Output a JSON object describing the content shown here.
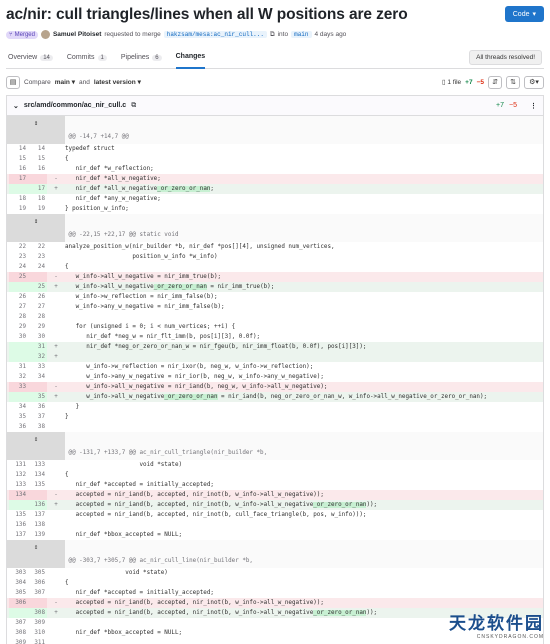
{
  "header": {
    "title": "ac/nir: cull triangles/lines when all W positions are zero",
    "code_button": "Code",
    "status": "Merged",
    "author": "Samuel Pitoiset",
    "request_text": "requested to merge",
    "source_branch": "hakzsam/mesa:ac_nir_cull...",
    "into_text": "into",
    "target_branch": "main",
    "time": "4 days ago"
  },
  "tabs": [
    {
      "label": "Overview",
      "count": "14"
    },
    {
      "label": "Commits",
      "count": "1"
    },
    {
      "label": "Pipelines",
      "count": "6"
    },
    {
      "label": "Changes",
      "count": ""
    }
  ],
  "threads_label": "All threads resolved!",
  "toolbar": {
    "compare": "Compare",
    "base": "main",
    "and": "and",
    "version": "latest version",
    "files": "1 file",
    "additions": "+7",
    "deletions": "−5"
  },
  "file": {
    "path": "src/amd/common/ac_nir_cull.c",
    "additions": "+7",
    "deletions": "−5"
  },
  "icons": [
    "sidebar-toggle-icon",
    "chevron-down-icon",
    "copy-icon",
    "more-vertical-icon",
    "settings-icon",
    "expand-icon",
    "merged-icon"
  ],
  "diff_rows": [
    {
      "t": "exp"
    },
    {
      "t": "hunk",
      "text": "@@ -14,7 +14,7 @@"
    },
    {
      "t": "ctx",
      "o": "14",
      "n": "14",
      "code": "typedef struct"
    },
    {
      "t": "ctx",
      "o": "15",
      "n": "15",
      "code": "{"
    },
    {
      "t": "ctx",
      "o": "16",
      "n": "16",
      "code": "   nir_def *w_reflection;"
    },
    {
      "t": "del",
      "o": "17",
      "n": "",
      "code": "   nir_def *all_w_negative;"
    },
    {
      "t": "add",
      "o": "",
      "n": "17",
      "code": "   nir_def *all_w_negative",
      "hl": "_or_zero_or_nan",
      "rest": ";"
    },
    {
      "t": "ctx",
      "o": "18",
      "n": "18",
      "code": "   nir_def *any_w_negative;"
    },
    {
      "t": "ctx",
      "o": "19",
      "n": "19",
      "code": "} position_w_info;"
    },
    {
      "t": "exp"
    },
    {
      "t": "hunk",
      "text": "@@ -22,15 +22,17 @@ static void"
    },
    {
      "t": "ctx",
      "o": "22",
      "n": "22",
      "code": "analyze_position_w(nir_builder *b, nir_def *pos[][4], unsigned num_vertices,"
    },
    {
      "t": "ctx",
      "o": "23",
      "n": "23",
      "code": "                   position_w_info *w_info)"
    },
    {
      "t": "ctx",
      "o": "24",
      "n": "24",
      "code": "{"
    },
    {
      "t": "del",
      "o": "25",
      "n": "",
      "code": "   w_info->all_w_negative = nir_imm_true(b);"
    },
    {
      "t": "add",
      "o": "",
      "n": "25",
      "code": "   w_info->all_w_negative",
      "hl": "_or_zero_or_nan",
      "rest": " = nir_imm_true(b);"
    },
    {
      "t": "ctx",
      "o": "26",
      "n": "26",
      "code": "   w_info->w_reflection = nir_imm_false(b);"
    },
    {
      "t": "ctx",
      "o": "27",
      "n": "27",
      "code": "   w_info->any_w_negative = nir_imm_false(b);"
    },
    {
      "t": "ctx",
      "o": "28",
      "n": "28",
      "code": ""
    },
    {
      "t": "ctx",
      "o": "29",
      "n": "29",
      "code": "   for (unsigned i = 0; i < num_vertices; ++i) {"
    },
    {
      "t": "ctx",
      "o": "30",
      "n": "30",
      "code": "      nir_def *neg_w = nir_flt_imm(b, pos[i][3], 0.0f);"
    },
    {
      "t": "add",
      "o": "",
      "n": "31",
      "code": "      nir_def *neg_or_zero_or_nan_w = nir_fgeu(b, nir_imm_float(b, 0.0f), pos[i][3]);"
    },
    {
      "t": "add",
      "o": "",
      "n": "32",
      "code": ""
    },
    {
      "t": "ctx",
      "o": "31",
      "n": "33",
      "code": "      w_info->w_reflection = nir_ixor(b, neg_w, w_info->w_reflection);"
    },
    {
      "t": "ctx",
      "o": "32",
      "n": "34",
      "code": "      w_info->any_w_negative = nir_ior(b, neg_w, w_info->any_w_negative);"
    },
    {
      "t": "del",
      "o": "33",
      "n": "",
      "code": "      w_info->all_w_negative = nir_iand(b, neg_w, w_info->all_w_negative);"
    },
    {
      "t": "add",
      "o": "",
      "n": "35",
      "code": "      w_info->all_w_negative",
      "hl": "_or_zero_or_nan",
      "rest": " = nir_iand(b, neg_or_zero_or_nan_w, w_info->all_w_negative_or_zero_or_nan);"
    },
    {
      "t": "ctx",
      "o": "34",
      "n": "36",
      "code": "   }"
    },
    {
      "t": "ctx",
      "o": "35",
      "n": "37",
      "code": "}"
    },
    {
      "t": "ctx",
      "o": "36",
      "n": "38",
      "code": ""
    },
    {
      "t": "exp2"
    },
    {
      "t": "hunk",
      "text": "@@ -131,7 +133,7 @@ ac_nir_cull_triangle(nir_builder *b,"
    },
    {
      "t": "ctx",
      "o": "131",
      "n": "133",
      "code": "                     void *state)"
    },
    {
      "t": "ctx",
      "o": "132",
      "n": "134",
      "code": "{"
    },
    {
      "t": "ctx",
      "o": "133",
      "n": "135",
      "code": "   nir_def *accepted = initially_accepted;"
    },
    {
      "t": "del",
      "o": "134",
      "n": "",
      "code": "   accepted = nir_iand(b, accepted, nir_inot(b, w_info->all_w_negative));"
    },
    {
      "t": "add",
      "o": "",
      "n": "136",
      "code": "   accepted = nir_iand(b, accepted, nir_inot(b, w_info->all_w_negative",
      "hl": "_or_zero_or_nan",
      "rest": "));"
    },
    {
      "t": "ctx",
      "o": "135",
      "n": "137",
      "code": "   accepted = nir_iand(b, accepted, nir_inot(b, cull_face_triangle(b, pos, w_info)));"
    },
    {
      "t": "ctx",
      "o": "136",
      "n": "138",
      "code": ""
    },
    {
      "t": "ctx",
      "o": "137",
      "n": "139",
      "code": "   nir_def *bbox_accepted = NULL;"
    },
    {
      "t": "exp2"
    },
    {
      "t": "hunk",
      "text": "@@ -303,7 +305,7 @@ ac_nir_cull_line(nir_builder *b,"
    },
    {
      "t": "ctx",
      "o": "303",
      "n": "305",
      "code": "                 void *state)"
    },
    {
      "t": "ctx",
      "o": "304",
      "n": "306",
      "code": "{"
    },
    {
      "t": "ctx",
      "o": "305",
      "n": "307",
      "code": "   nir_def *accepted = initially_accepted;"
    },
    {
      "t": "del",
      "o": "306",
      "n": "",
      "code": "   accepted = nir_iand(b, accepted, nir_inot(b, w_info->all_w_negative));"
    },
    {
      "t": "add",
      "o": "",
      "n": "308",
      "code": "   accepted = nir_iand(b, accepted, nir_inot(b, w_info->all_w_negative",
      "hl": "_or_zero_or_nan",
      "rest": "));"
    },
    {
      "t": "ctx",
      "o": "307",
      "n": "309",
      "code": ""
    },
    {
      "t": "ctx",
      "o": "308",
      "n": "310",
      "code": "   nir_def *bbox_accepted = NULL;"
    },
    {
      "t": "ctx",
      "o": "309",
      "n": "311",
      "code": ""
    },
    {
      "t": "exp"
    }
  ],
  "watermark": {
    "big": "天龙软件园",
    "small": "CNSKYDRAGON.COM"
  }
}
